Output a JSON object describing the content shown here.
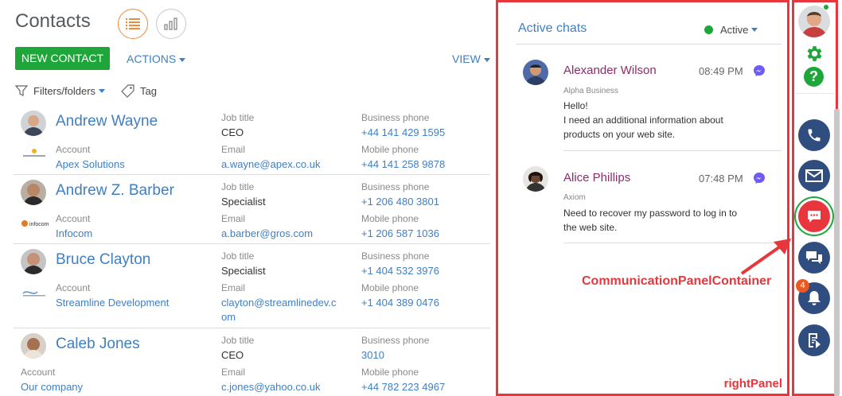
{
  "header": {
    "title": "Contacts",
    "new_contact": "NEW CONTACT",
    "actions": "ACTIONS",
    "view": "VIEW",
    "filters": "Filters/folders",
    "tag": "Tag"
  },
  "contacts": [
    {
      "name": "Andrew Wayne",
      "job_label": "Job title",
      "job": "CEO",
      "bphone_label": "Business phone",
      "bphone": "+44 141 429 1595",
      "account_label": "Account",
      "account": "Apex Solutions",
      "email_label": "Email",
      "email": "a.wayne@apex.co.uk",
      "mphone_label": "Mobile phone",
      "mphone": "+44 141 258 9878"
    },
    {
      "name": "Andrew Z. Barber",
      "job_label": "Job title",
      "job": "Specialist",
      "bphone_label": "Business phone",
      "bphone": "+1 206 480 3801",
      "account_label": "Account",
      "account": "Infocom",
      "email_label": "Email",
      "email": "a.barber@gros.com",
      "mphone_label": "Mobile phone",
      "mphone": "+1 206 587 1036"
    },
    {
      "name": "Bruce Clayton",
      "job_label": "Job title",
      "job": "Specialist",
      "bphone_label": "Business phone",
      "bphone": "+1 404 532 3976",
      "account_label": "Account",
      "account": "Streamline Development",
      "email_label": "Email",
      "email_line1": "clayton@streamlinedev.c",
      "email_line2": "om",
      "mphone_label": "Mobile phone",
      "mphone": "+1 404 389 0476"
    },
    {
      "name": "Caleb Jones",
      "job_label": "Job title",
      "job": "CEO",
      "bphone_label": "Business phone",
      "bphone": "3010",
      "account_label": "Account",
      "account": "Our company",
      "email_label": "Email",
      "email": "c.jones@yahoo.co.uk",
      "mphone_label": "Mobile phone",
      "mphone": "+44 782 223 4967"
    }
  ],
  "account_logos": [
    "Apex Solutions",
    "infocom",
    "Streamline"
  ],
  "chats": {
    "title": "Active chats",
    "status": "Active",
    "items": [
      {
        "name": "Alexander Wilson",
        "time": "08:49 PM",
        "company": "Alpha Business",
        "msg1": "Hello!",
        "msg2": "I need an additional information about",
        "msg3": "products on your web site."
      },
      {
        "name": "Alice Phillips",
        "time": "07:48 PM",
        "company": "Axiom",
        "msg1": "Need to recover my password to log in to",
        "msg2": "the web site."
      }
    ],
    "panel_label": "rightPanel"
  },
  "comm_panel": {
    "notification_count": "4",
    "annotation": "CommunicationPanelContainer"
  },
  "colors": {
    "accent": "#3f7fc4",
    "primary_button": "#1ea63a",
    "annotation_red": "#e8373c",
    "panel_buttons": "#2f4d7e",
    "chat_name": "#8d2c6b"
  }
}
